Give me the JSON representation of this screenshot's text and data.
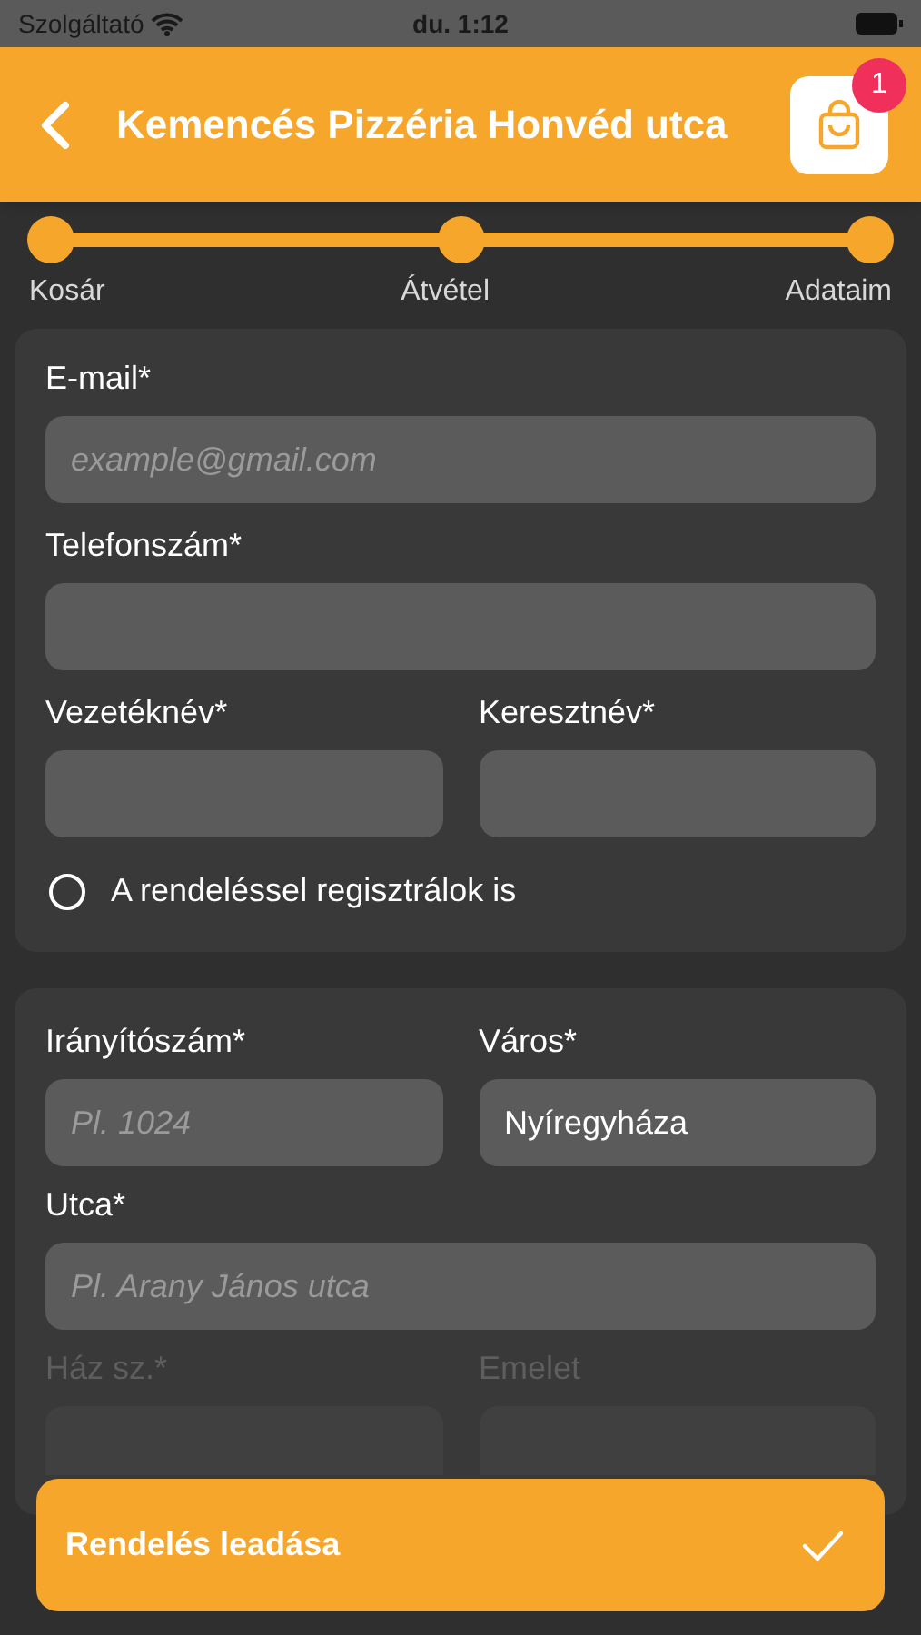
{
  "status_bar": {
    "carrier": "Szolgáltató",
    "time": "du. 1:12"
  },
  "header": {
    "title": "Kemencés Pizzéria Honvéd utca",
    "cart_count": "1"
  },
  "steps": [
    {
      "label": "Kosár",
      "completed": true
    },
    {
      "label": "Átvétel",
      "completed": true
    },
    {
      "label": "Adataim",
      "completed": true
    }
  ],
  "contact_card": {
    "rows": [
      [
        {
          "label": "E-mail*",
          "placeholder": "example@gmail.com"
        }
      ],
      [
        {
          "label": "Telefonszám*"
        }
      ],
      [
        {
          "label": "Vezetéknév*"
        },
        {
          "label": "Keresztnév*"
        }
      ]
    ],
    "register": {
      "label": "A rendeléssel regisztrálok is",
      "checked": false
    }
  },
  "address_card": {
    "rows": [
      [
        {
          "label": "Irányítószám*",
          "placeholder": "Pl. 1024"
        },
        {
          "label": "Város*",
          "value": "Nyíregyháza"
        }
      ],
      [
        {
          "label": "Utca*",
          "placeholder": "Pl. Arany János utca"
        }
      ]
    ],
    "faded_rows": [
      [
        {
          "label": "Ház sz.*"
        },
        {
          "label": "Emelet"
        }
      ]
    ]
  },
  "submit": {
    "label": "Rendelés leadása"
  }
}
